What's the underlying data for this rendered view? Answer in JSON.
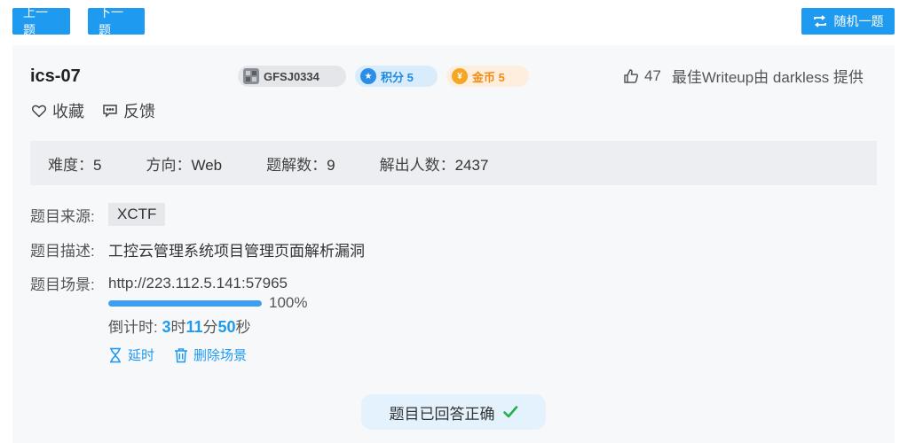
{
  "nav": {
    "prev_label": "上一题",
    "next_label": "下一题",
    "random_label": "随机一题"
  },
  "challenge": {
    "title": "ics-07",
    "author_tag": "GFSJ0334",
    "points_label": "积分 5",
    "coins_label": "金币 5",
    "likes_count": "47",
    "writeup_text": "最佳Writeup由 darkless 提供",
    "favorite_label": "收藏",
    "feedback_label": "反馈"
  },
  "stats": {
    "difficulty_label": "难度：",
    "difficulty_value": "5",
    "direction_label": "方向：",
    "direction_value": "Web",
    "solves_label": "题解数：",
    "solves_value": "9",
    "solvers_label": "解出人数：",
    "solvers_value": "2437"
  },
  "details": {
    "source_label": "题目来源:",
    "source_value": "XCTF",
    "desc_label": "题目描述:",
    "desc_value": "工控云管理系统项目管理页面解析漏洞",
    "scene_label": "题目场景:",
    "scene_url": "http://223.112.5.141:57965",
    "progress_percent": 100,
    "progress_text": "100%"
  },
  "countdown": {
    "prefix": "倒计时: ",
    "hours": "3",
    "hours_unit": "时",
    "minutes": "11",
    "minutes_unit": "分",
    "seconds": "50",
    "seconds_unit": "秒"
  },
  "scene_actions": {
    "extend_label": "延时",
    "delete_label": "删除场景"
  },
  "status": {
    "answered_label": "题目已回答正确"
  },
  "colors": {
    "accent": "#1e9af0",
    "success": "#22b04b",
    "coins": "#ef8d15",
    "points": "#1e8ae0"
  }
}
